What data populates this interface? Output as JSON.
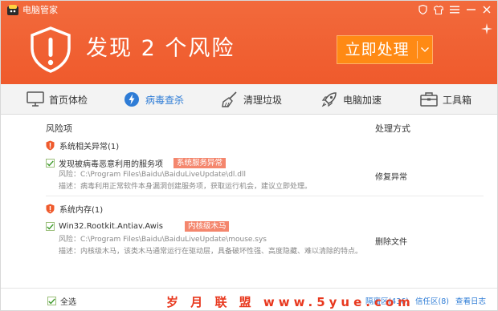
{
  "app": {
    "title": "电脑管家"
  },
  "header": {
    "headline": "发现 2 个风险",
    "fix_button": "立即处理"
  },
  "nav": {
    "items": [
      {
        "label": "首页体检",
        "icon": "monitor-icon"
      },
      {
        "label": "病毒查杀",
        "icon": "virus-scan-icon",
        "active": true
      },
      {
        "label": "清理垃圾",
        "icon": "broom-icon"
      },
      {
        "label": "电脑加速",
        "icon": "rocket-icon"
      },
      {
        "label": "工具箱",
        "icon": "toolbox-icon"
      }
    ]
  },
  "table": {
    "col_risk": "风险项",
    "col_action": "处理方式",
    "groups": [
      {
        "label": "系统相关异常(1)",
        "items": [
          {
            "title": "发现被病毒恶意利用的服务项",
            "tag": "系统服务异常",
            "risk_line": "风险：C:\\Program Files\\Baidu\\BaiduLiveUpdate\\dl.dll",
            "desc_line": "描述：病毒利用正常软件本身漏洞创建服务项，获取运行机会，建议立即处理。",
            "action": "修复异常",
            "checked": true
          }
        ]
      },
      {
        "label": "系统内存(1)",
        "items": [
          {
            "title": "Win32.Rootkit.Antiav.Awis",
            "tag": "内核级木马",
            "risk_line": "风险：C:\\Program Files\\Baidu\\BaiduLiveUpdate\\mouse.sys",
            "desc_line": "描述：内核级木马，该类木马通常运行在驱动层，具备破坏性强、高度隐藏、难以清除的特点。",
            "action": "删除文件",
            "checked": true
          }
        ]
      }
    ]
  },
  "footer": {
    "select_all": "全选",
    "links": [
      "隔离区(436)",
      "信任区(8)",
      "查看日志"
    ]
  },
  "watermark": "岁 月 联 盟   www.5yue.com",
  "colors": {
    "header": "#ef5a2c",
    "button": "#ff8a14",
    "accent": "#2e7cd6",
    "tag": "#f4866d"
  }
}
